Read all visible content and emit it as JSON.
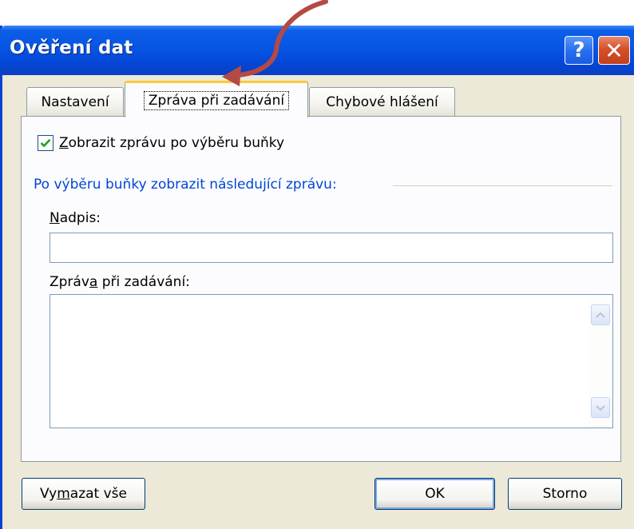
{
  "window": {
    "title": "Ověření dat",
    "help_symbol": "?",
    "close_symbol": "✕"
  },
  "tabs": [
    {
      "label": "Nastavení"
    },
    {
      "label": "Zpráva při zadávání",
      "selected": true
    },
    {
      "label": "Chybové hlášení"
    }
  ],
  "panel": {
    "show_message_checkbox": {
      "checked": true,
      "label_accel": "Z",
      "label_rest": "obrazit zprávu po výběru buňky"
    },
    "group_label": "Po výběru buňky zobrazit následující zprávu:",
    "title_field": {
      "label_accel": "N",
      "label_rest": "adpis:",
      "value": ""
    },
    "message_field": {
      "label_before": "Zpráv",
      "label_accel": "a",
      "label_after": " při zadávání:",
      "value": ""
    }
  },
  "buttons": {
    "clear_before": "Vy",
    "clear_accel": "m",
    "clear_after": "azat vše",
    "ok": "OK",
    "cancel": "Storno"
  },
  "colors": {
    "accent_title": "#0755e4",
    "group_label": "#0046d5",
    "active_tab_highlight": "#ffc83c",
    "annotation_arrow": "#b34a44"
  },
  "icons": [
    "help-icon",
    "close-icon",
    "checkmark-icon",
    "scroll-up-icon",
    "scroll-down-icon",
    "annotation-arrow"
  ]
}
